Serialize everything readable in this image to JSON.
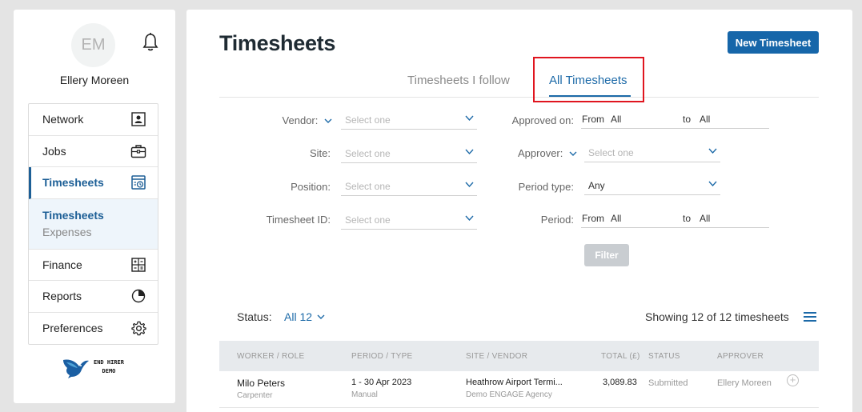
{
  "user": {
    "initials": "EM",
    "name": "Ellery Moreen"
  },
  "nav": {
    "network": "Network",
    "jobs": "Jobs",
    "timesheets": "Timesheets",
    "sub_timesheets": "Timesheets",
    "sub_expenses": "Expenses",
    "finance": "Finance",
    "reports": "Reports",
    "preferences": "Preferences"
  },
  "logo": {
    "line1": "END HIRER",
    "line2": "DEMO"
  },
  "page": {
    "title": "Timesheets",
    "new_button": "New Timesheet"
  },
  "tabs": {
    "follow": "Timesheets I follow",
    "all": "All Timesheets"
  },
  "filters": {
    "vendor_label": "Vendor:",
    "site_label": "Site:",
    "position_label": "Position:",
    "timesheet_id_label": "Timesheet ID:",
    "placeholder": "Select one",
    "approved_on_label": "Approved on:",
    "approver_label": "Approver:",
    "period_type_label": "Period type:",
    "period_type_value": "Any",
    "period_label": "Period:",
    "from": "From",
    "to": "to",
    "all": "All",
    "filter_button": "Filter"
  },
  "status": {
    "label": "Status:",
    "value": "All 12"
  },
  "showing": "Showing 12 of 12 timesheets",
  "table": {
    "headers": [
      "WORKER / ROLE",
      "PERIOD / TYPE",
      "SITE / VENDOR",
      "TOTAL (£)",
      "STATUS",
      "APPROVER"
    ],
    "rows": [
      {
        "worker": "Milo Peters",
        "role": "Carpenter",
        "period": "1 - 30 Apr 2023",
        "type": "Manual",
        "site": "Heathrow Airport Termi...",
        "vendor": "Demo ENGAGE Agency",
        "total": "3,089.83",
        "status": "Submitted",
        "approver": "Ellery Moreen"
      }
    ]
  },
  "colors": {
    "accent": "#1666a9",
    "highlight": "#e0151f"
  }
}
